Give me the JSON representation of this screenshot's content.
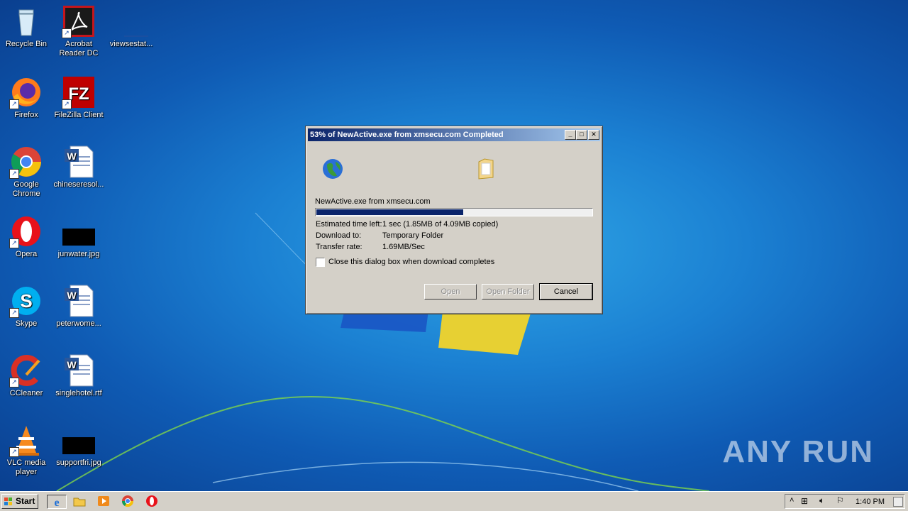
{
  "desktop": {
    "icons": [
      {
        "label": "Recycle Bin"
      },
      {
        "label": "Acrobat Reader DC"
      },
      {
        "label": "viewsestat..."
      },
      {
        "label": "Firefox"
      },
      {
        "label": "FileZilla Client"
      },
      {
        "label": "Google Chrome"
      },
      {
        "label": "chineseresol..."
      },
      {
        "label": "Opera"
      },
      {
        "label": "junwater.jpg"
      },
      {
        "label": "Skype"
      },
      {
        "label": "peterwome..."
      },
      {
        "label": "CCleaner"
      },
      {
        "label": "singlehotel.rtf"
      },
      {
        "label": "VLC media player"
      },
      {
        "label": "supportfri.jpg"
      }
    ],
    "watermark": "ANY RUN"
  },
  "dialog": {
    "title": "53% of NewActive.exe from xmsecu.com Completed",
    "source": "NewActive.exe from xmsecu.com",
    "progress_percent": 53,
    "rows": [
      {
        "label": "Estimated time left:",
        "value": "1 sec (1.85MB of 4.09MB copied)"
      },
      {
        "label": "Download to:",
        "value": "Temporary Folder"
      },
      {
        "label": "Transfer rate:",
        "value": "1.69MB/Sec"
      }
    ],
    "checkbox_label": "Close this dialog box when download completes",
    "buttons": {
      "open": "Open",
      "open_folder": "Open Folder",
      "cancel": "Cancel"
    }
  },
  "taskbar": {
    "start_label": "Start",
    "clock": "1:40 PM"
  }
}
